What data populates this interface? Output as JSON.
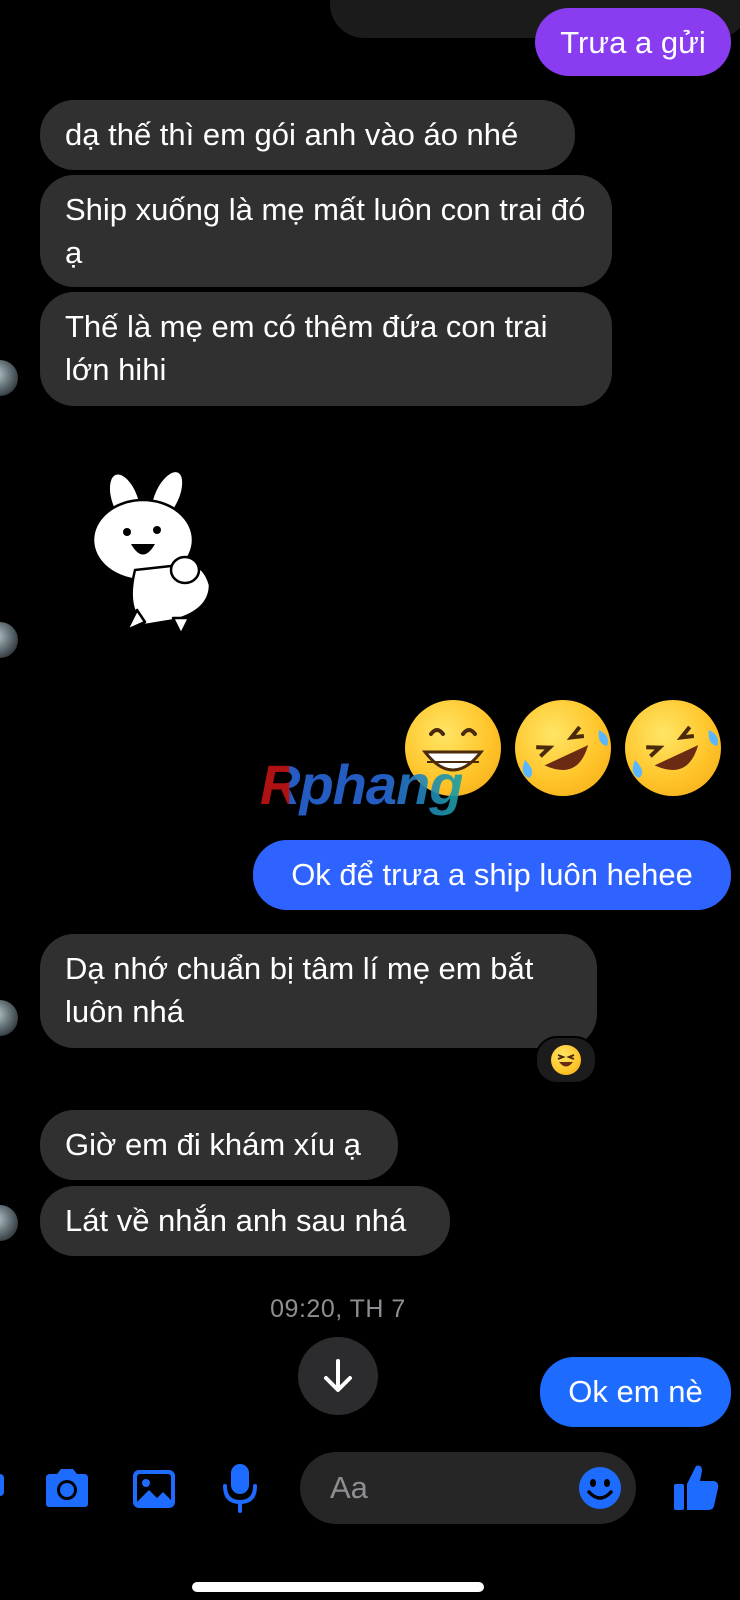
{
  "messages": {
    "top_out": "Trưa a gửi",
    "m1": "dạ thế thì em gói anh vào áo nhé",
    "m2": "Ship xuống là mẹ mất luôn con trai đó ạ",
    "m3": "Thế là mẹ em có thêm đứa con trai lớn hihi",
    "out_ok": "Ok để trưa a ship luôn hehee",
    "m4": "Dạ nhớ chuẩn bị tâm lí mẹ em bắt luôn nhá",
    "m5": "Giờ em đi khám xíu ạ",
    "m6": "Lát về nhắn anh sau nhá",
    "out_last": "Ok em nè"
  },
  "timestamp": "09:20, TH 7",
  "watermark": "Rphang",
  "reaction": "😆",
  "emoji_message": [
    "😁",
    "🤣",
    "🤣"
  ],
  "input": {
    "placeholder": "Aa"
  },
  "icons": {
    "camera": "camera-icon",
    "image": "image-icon",
    "mic": "microphone-icon",
    "emoji": "emoji-icon",
    "like": "thumbs-up-icon",
    "scroll": "arrow-down-icon"
  },
  "colors": {
    "bg": "#000000",
    "incoming": "#303030",
    "outgoing_blue": "#2f6bff",
    "outgoing_purple": "#8b3cf0",
    "accent": "#1e6bff"
  }
}
